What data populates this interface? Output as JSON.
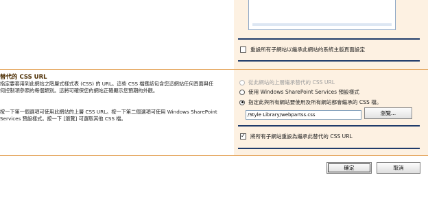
{
  "master_page": {
    "reset_subsites_label": "重設所有子網站以繼承此網站的系統主版頁面設定",
    "reset_subsites_checked": false
  },
  "alternate_css": {
    "title": "替代的 CSS URL",
    "description_1": "指定要套用到此網站之階層式樣式表 (CSS) 的 URL。這些 CSS 檔應該包含您這網站任何頁面與任何控制項參照的每個類別。這將可確保您的網站正確顯示您預期的外觀。",
    "description_2": "按一下第一個選項可使用此網站的上層 CSS URL。按一下第二個選項可使用 Windows SharePoint Services 預設樣式。按一下 [瀏覽] 可選取其他 CSS 檔。",
    "options": [
      {
        "label": "從此網站的上層繼承替代的 CSS URL",
        "selected": false,
        "disabled": true
      },
      {
        "label": "使用 Windows SharePoint Services 預設樣式",
        "selected": false,
        "disabled": false
      },
      {
        "label": "指定此與所有網站要使用及所有網站都會繼承的 CSS 檔。",
        "selected": true,
        "disabled": false
      }
    ],
    "css_url_value": "/Style Library/webpartss.css",
    "browse_label": "瀏覽...",
    "reset_subsites_label": "將所有子網站重設為繼承此替代的 CSS URL",
    "reset_subsites_checked": true
  },
  "footer": {
    "ok_label": "確定",
    "cancel_label": "取消"
  }
}
